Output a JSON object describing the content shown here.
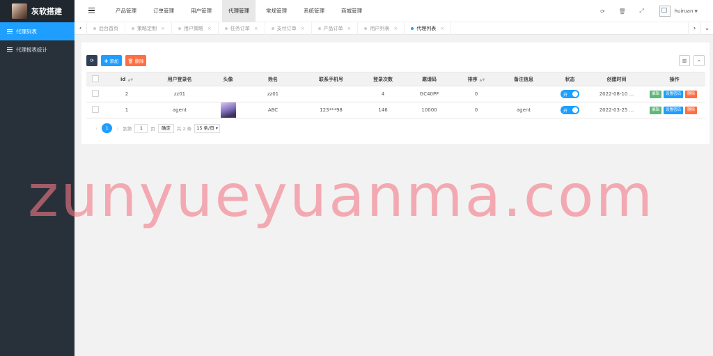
{
  "brand": {
    "name": "灰软搭建"
  },
  "sidebar": {
    "items": [
      {
        "label": "代理列表",
        "active": true
      },
      {
        "label": "代理报表统计",
        "active": false
      }
    ]
  },
  "topnav": {
    "items": [
      {
        "label": "产品管理",
        "active": false
      },
      {
        "label": "订单管理",
        "active": false
      },
      {
        "label": "用户管理",
        "active": false
      },
      {
        "label": "代理管理",
        "active": true
      },
      {
        "label": "常规管理",
        "active": false
      },
      {
        "label": "系统管理",
        "active": false
      },
      {
        "label": "商城管理",
        "active": false
      }
    ],
    "username": "huiruan"
  },
  "tabs": [
    {
      "label": "后台首页",
      "closable": false
    },
    {
      "label": "策略定制",
      "closable": true
    },
    {
      "label": "用户策略",
      "closable": true
    },
    {
      "label": "任务订单",
      "closable": true
    },
    {
      "label": "支付订单",
      "closable": true
    },
    {
      "label": "产品订单",
      "closable": true
    },
    {
      "label": "用户列表",
      "closable": true
    },
    {
      "label": "代理列表",
      "closable": true,
      "active": true
    }
  ],
  "toolbar": {
    "add_label": "✚ 添加",
    "delete_label": "🗑 删除"
  },
  "table": {
    "headers": {
      "id": "id",
      "login": "用户登录名",
      "avatar": "头像",
      "name": "姓名",
      "phone": "联系手机号",
      "logins": "登录次数",
      "invite": "邀请码",
      "sort": "排序",
      "remark": "备注信息",
      "status": "状态",
      "created": "创建时间",
      "ops": "操作"
    },
    "rows": [
      {
        "id": "2",
        "login": "zz01",
        "name": "zz01",
        "phone": "",
        "logins": "4",
        "invite": "GC40PF",
        "sort": "0",
        "remark": "",
        "status": "开",
        "created": "2022-08-10 ...",
        "has_avatar": false
      },
      {
        "id": "1",
        "login": "agent",
        "name": "ABC",
        "phone": "123***98",
        "logins": "146",
        "invite": "10000",
        "sort": "0",
        "remark": "agent",
        "status": "开",
        "created": "2022-03-25 ...",
        "has_avatar": true
      }
    ],
    "ops": {
      "edit": "编辑",
      "pwd": "设置密码",
      "del": "删除"
    }
  },
  "pager": {
    "current": "1",
    "goto_label": "到第",
    "page_input": "1",
    "page_unit": "页",
    "confirm": "确定",
    "total": "共 2 条",
    "per_page": "15 条/页"
  },
  "watermark": "zunyueyuanma.com",
  "colors": {
    "accent": "#1e9fff",
    "sidebar": "#28313a",
    "edit": "#5fb878",
    "danger": "#ff5722"
  }
}
